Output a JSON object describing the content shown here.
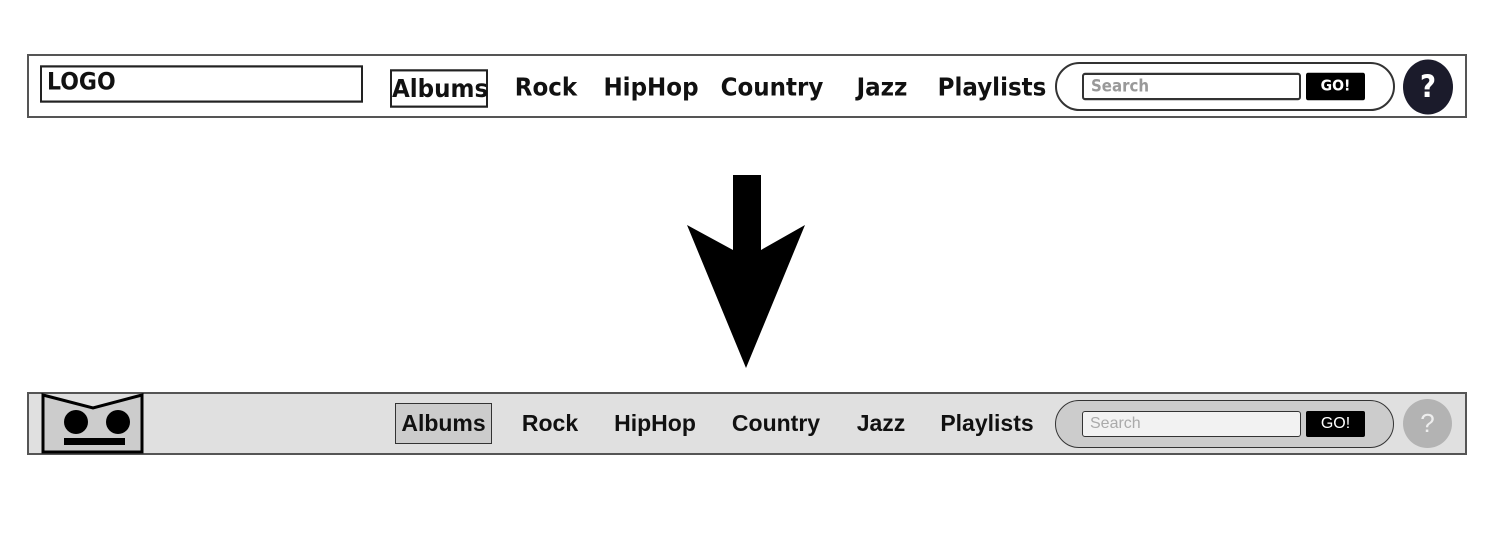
{
  "sketch": {
    "logo": "LOGO",
    "nav": [
      "Albums",
      "Rock",
      "HipHop",
      "Country",
      "Jazz",
      "Playlists"
    ],
    "active": "Albums",
    "search_placeholder": "Search",
    "go_label": "GO!",
    "help_label": "?"
  },
  "arrow": {
    "icon": "arrow-down-icon",
    "color": "#000000"
  },
  "final": {
    "logo_icon": "robot-face-logo",
    "nav": [
      "Albums",
      "Rock",
      "HipHop",
      "Country",
      "Jazz",
      "Playlists"
    ],
    "active": "Albums",
    "search_placeholder": "Search",
    "go_label": "GO!",
    "help_label": "?",
    "colors": {
      "bar": "#e0e0e0",
      "active": "#cccccc",
      "help": "#b3b3b3"
    }
  }
}
